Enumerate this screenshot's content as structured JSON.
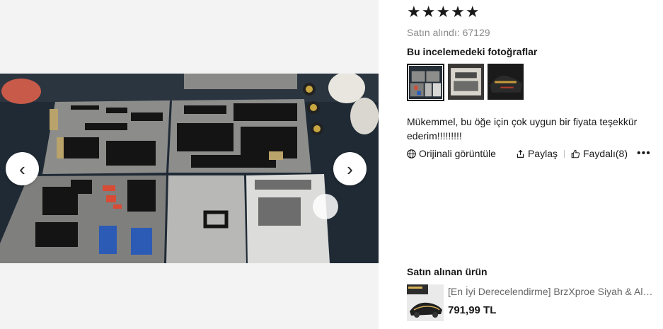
{
  "review": {
    "rating_stars": "★★★★★",
    "rating": 5,
    "bought_label": "Satın alındı:",
    "bought_count": "67129",
    "photos_title": "Bu incelemedeki fotoğraflar",
    "text": "Mükemmel, bu öğe için çok uygun bir fiyata teşekkür ederim!!!!!!!!!",
    "actions": {
      "original_label": "Orijinali görüntüle",
      "share_label": "Paylaş",
      "helpful_label": "Faydalı(8)",
      "more_label": "•••"
    }
  },
  "gallery": {
    "prev_glyph": "‹",
    "next_glyph": "›"
  },
  "purchased": {
    "title": "Satın alınan ürün",
    "product_name": "[En İyi Derecelendirme] BrzXproe Siyah & Altın Teknik Araba Yapı Taşları Seti",
    "price": "791,99 TL"
  },
  "icons": {
    "globe": "globe-icon",
    "share": "share-icon",
    "thumbs_up": "thumbs-up-icon",
    "more": "more-icon"
  }
}
